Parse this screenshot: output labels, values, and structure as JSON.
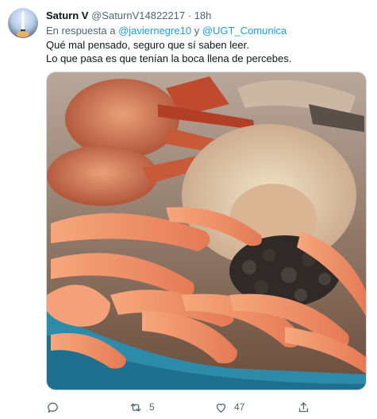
{
  "tweet": {
    "author_name": "Saturn V",
    "author_handle": "@SaturnV14822217",
    "separator": "·",
    "time": "18h",
    "reply_prefix": "En respuesta a",
    "mention1": "@javiernegre10",
    "reply_joiner": "y",
    "mention2": "@UGT_Comunica",
    "text_line1": "Qué mal pensado, seguro que sí saben leer.",
    "text_line2": "Lo que pasa es que tenían la boca llena de percebes.",
    "media_subject": "seafood-platter-photo"
  },
  "actions": {
    "reply_count": "",
    "retweet_count": "5",
    "like_count": "47"
  }
}
